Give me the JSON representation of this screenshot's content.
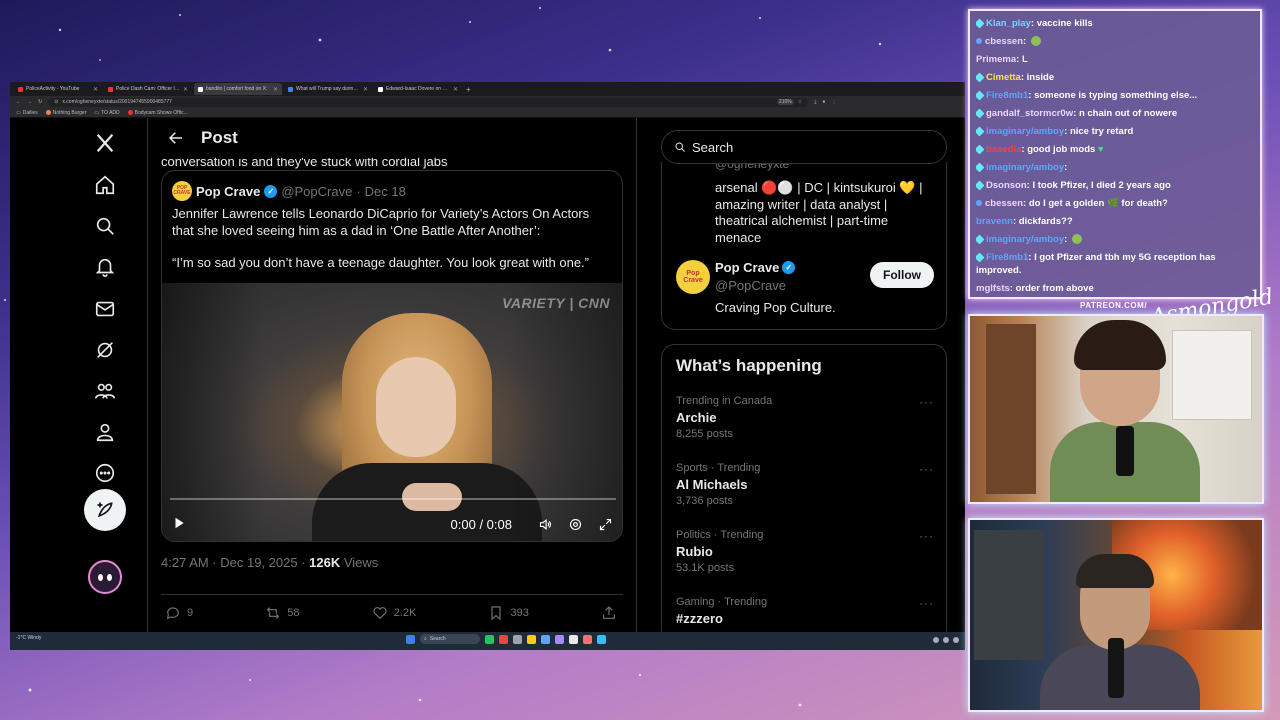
{
  "browser": {
    "tabs": [
      {
        "label": "PoliceActivity - YouTube",
        "active": false
      },
      {
        "label": "Police Dash Cam: Officer Involv...",
        "active": false
      },
      {
        "label": "bandito | comfort food on X:",
        "active": true
      },
      {
        "label": "What will Trump say during the...",
        "active": false
      },
      {
        "label": "Edward-Isaac Dovere on X: \"In...",
        "active": false
      }
    ],
    "url": "x.com/ogheneyxte/status/2001947455900485777",
    "zoom": "210%",
    "bookmarks": [
      "Dailies",
      "Nothing Burger",
      "TO ADD",
      "Bodycam Shows Offic..."
    ]
  },
  "post": {
    "header_title": "Post",
    "prev_text": "conversation is and they've stuck with cordial jabs",
    "quote": {
      "author_name": "Pop Crave",
      "author_handle": "@PopCrave",
      "date": "Dec 18",
      "avatar_text": "POP CRAVE",
      "paragraph1": "Jennifer Lawrence tells Leonardo DiCaprio for Variety’s Actors On Actors that she loved seeing him as a dad in ‘One Battle After Another’:",
      "paragraph2": "“I’m so sad you don’t have a teenage daughter. You look great with one.”"
    },
    "video": {
      "watermark": "VARIETY | CNN",
      "time": "0:00 / 0:08",
      "progress": 0
    },
    "meta": {
      "time": "4:27 AM · Dec 19, 2025 ·",
      "views_count": "126K",
      "views_label": "Views"
    },
    "actions": {
      "replies": "9",
      "reposts": "58",
      "likes": "2.2K",
      "bookmarks": "393"
    }
  },
  "sidebar": {
    "search_placeholder": "Search",
    "prev_handle": "@ogheneyxte",
    "prev_bio": "arsenal 🔴⚪ | DC | kintsukuroi 💛 | amazing writer | data analyst | theatrical alchemist | part-time menace",
    "popcrave": {
      "name": "Pop Crave",
      "handle": "@PopCrave",
      "follow_label": "Follow",
      "bio": "Craving Pop Culture."
    },
    "trends_title": "What’s happening",
    "trends": [
      {
        "context": "Trending in Canada",
        "name": "Archie",
        "posts": "8,255 posts"
      },
      {
        "context": "Sports · Trending",
        "name": "Al Michaels",
        "posts": "3,736 posts"
      },
      {
        "context": "Politics · Trending",
        "name": "Rubio",
        "posts": "53.1K posts"
      },
      {
        "context": "Gaming · Trending",
        "name": "#zzzero",
        "posts": ""
      }
    ]
  },
  "taskbar": {
    "weather": "-1°C Windy",
    "search": "Search"
  },
  "chat": {
    "messages": [
      {
        "user": "Klan_play",
        "text": "vaccine kills",
        "color": "#7dd3fc"
      },
      {
        "user": "cbessen",
        "text": "",
        "color": "#e9d5ff"
      },
      {
        "user": "Primema",
        "text": "L",
        "color": "#e9d5ff"
      },
      {
        "user": "Cimetta",
        "text": "inside",
        "color": "#fde047"
      },
      {
        "user": "Fire8mb1",
        "text": "someone is typing something else...",
        "color": "#60a5fa"
      },
      {
        "user": "gandalf_stormcr0w",
        "text": "n chain out of nowere",
        "color": "#e9d5ff"
      },
      {
        "user": "imaginary/amboy",
        "text": "nice try retard",
        "color": "#60a5fa"
      },
      {
        "user": "basedla",
        "text": "good job mods",
        "color": "#ef4444"
      },
      {
        "user": "imaginary/amboy",
        "text": "",
        "color": "#60a5fa"
      },
      {
        "user": "Dsonson",
        "text": "I took Pfizer, I died 2 years ago",
        "color": "#e9d5ff"
      },
      {
        "user": "cbessen",
        "text": "do I get a golden 🌿 for death?",
        "color": "#e9d5ff"
      },
      {
        "user": "bravenn",
        "text": "dickfards??",
        "color": "#60a5fa"
      },
      {
        "user": "imaginary/amboy",
        "text": "",
        "color": "#60a5fa"
      },
      {
        "user": "Fire8mb1",
        "text": "I got Pfizer and tbh my 5G reception has improved.",
        "color": "#60a5fa"
      },
      {
        "user": "mglfsts",
        "text": "order from above",
        "color": "#e9d5ff"
      }
    ],
    "patreon": "PATREON.COM/",
    "signature": "Asmongold"
  }
}
